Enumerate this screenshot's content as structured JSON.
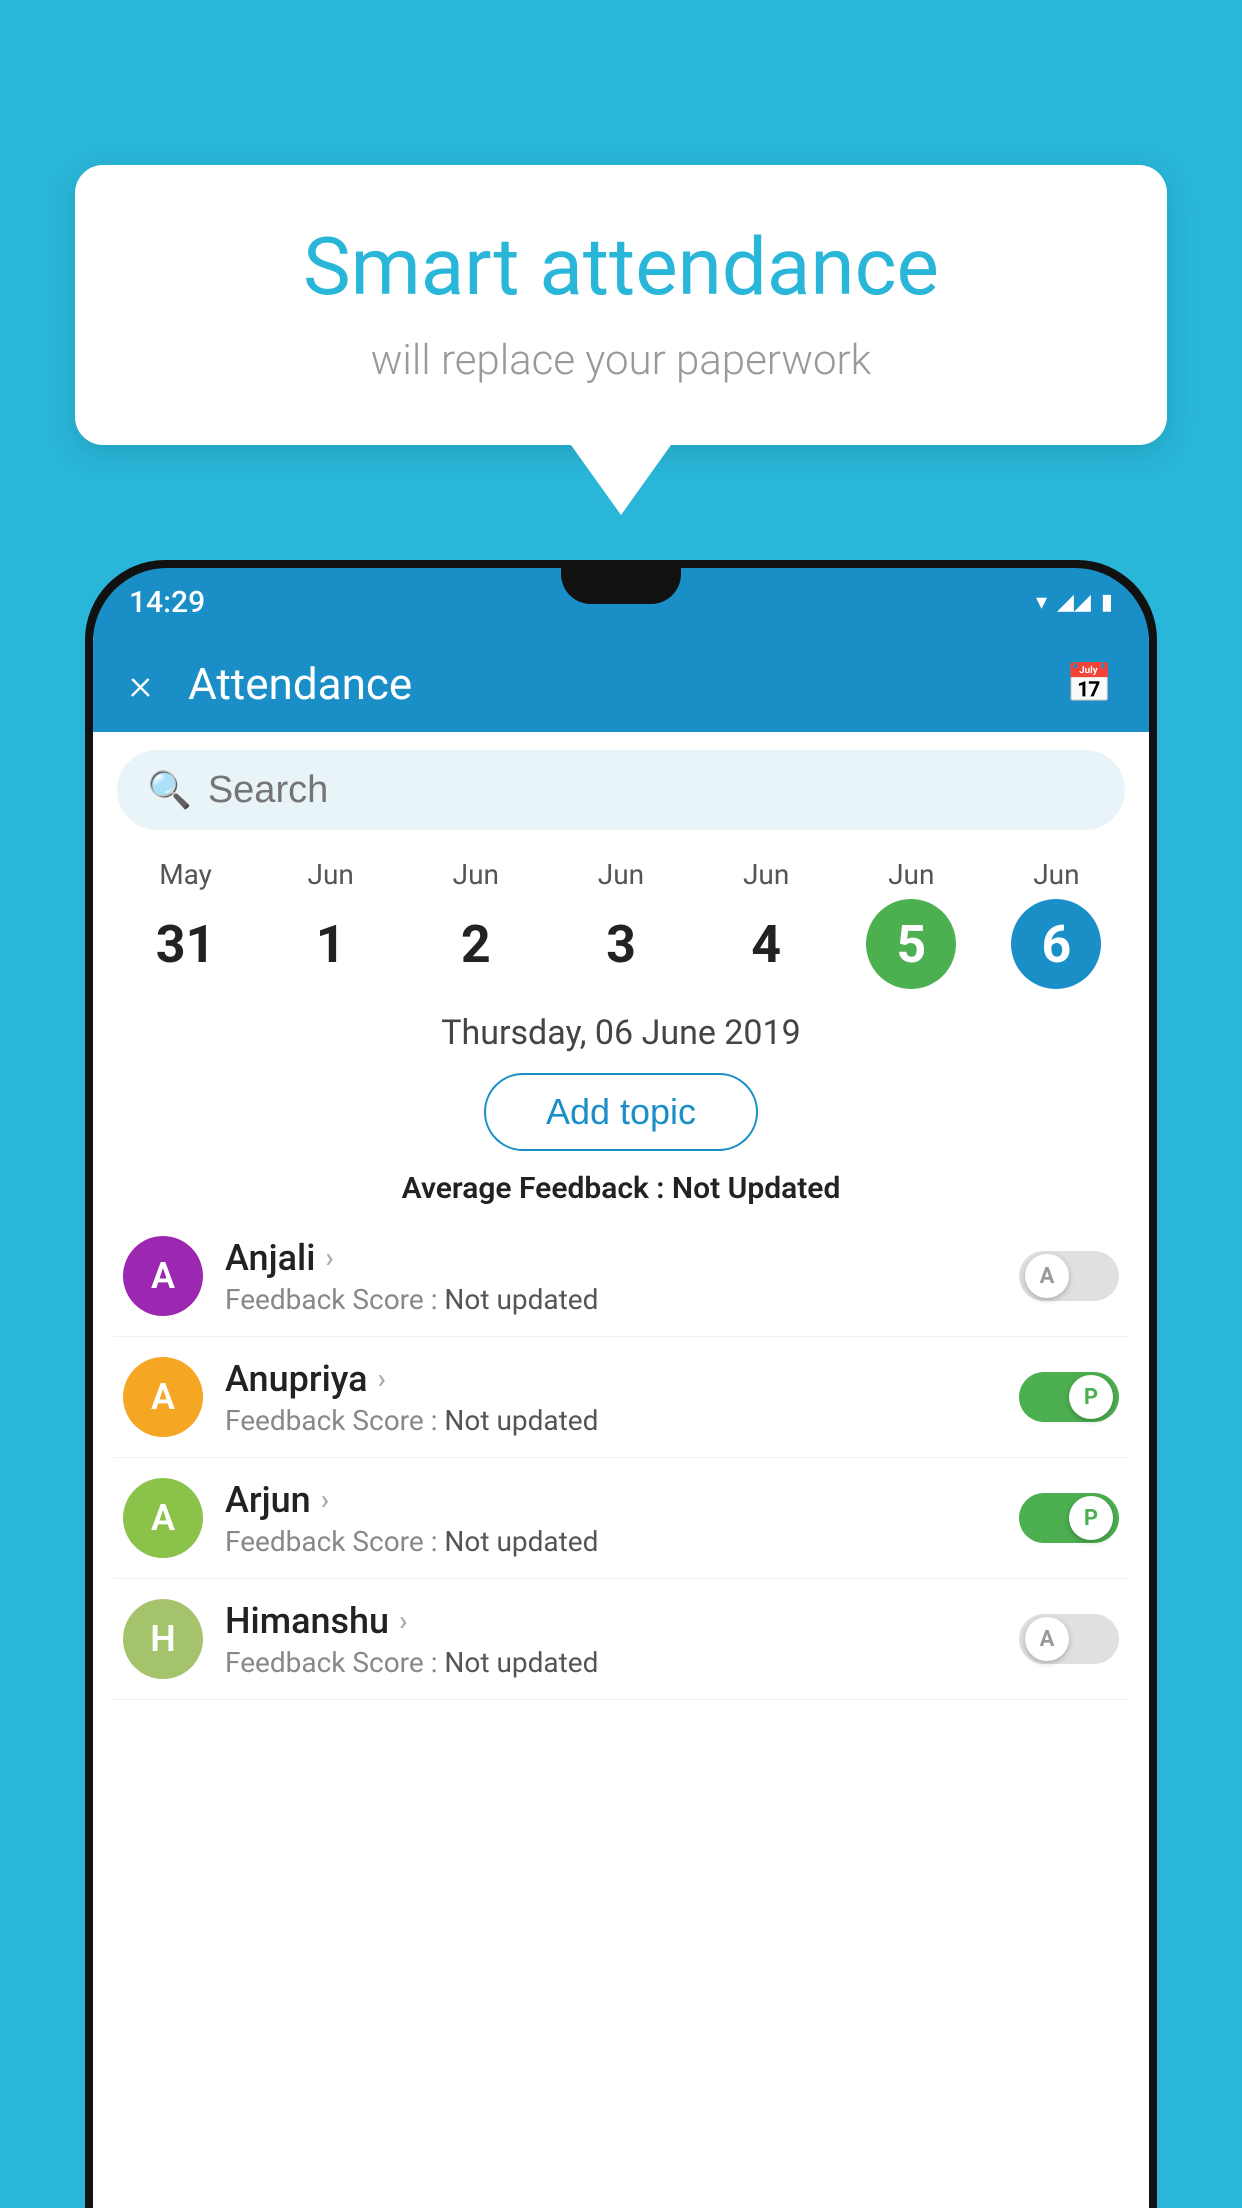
{
  "background_color": "#29b6d8",
  "hero": {
    "title": "Smart attendance",
    "subtitle": "will replace your paperwork"
  },
  "app": {
    "status_bar": {
      "time": "14:29"
    },
    "header": {
      "title": "Attendance",
      "close_label": "×",
      "calendar_icon": "📅"
    },
    "search": {
      "placeholder": "Search"
    },
    "calendar": {
      "days": [
        {
          "month": "May",
          "date": "31",
          "state": "normal"
        },
        {
          "month": "Jun",
          "date": "1",
          "state": "normal"
        },
        {
          "month": "Jun",
          "date": "2",
          "state": "normal"
        },
        {
          "month": "Jun",
          "date": "3",
          "state": "normal"
        },
        {
          "month": "Jun",
          "date": "4",
          "state": "normal"
        },
        {
          "month": "Jun",
          "date": "5",
          "state": "today"
        },
        {
          "month": "Jun",
          "date": "6",
          "state": "selected"
        }
      ]
    },
    "date_label": "Thursday, 06 June 2019",
    "add_topic_label": "Add topic",
    "avg_feedback_label": "Average Feedback :",
    "avg_feedback_value": "Not Updated",
    "students": [
      {
        "name": "Anjali",
        "avatar_letter": "A",
        "avatar_color": "#9c27b0",
        "feedback_label": "Feedback Score :",
        "feedback_value": "Not updated",
        "toggle_state": "off",
        "toggle_letter": "A"
      },
      {
        "name": "Anupriya",
        "avatar_letter": "A",
        "avatar_color": "#f5a623",
        "feedback_label": "Feedback Score :",
        "feedback_value": "Not updated",
        "toggle_state": "on-present",
        "toggle_letter": "P"
      },
      {
        "name": "Arjun",
        "avatar_letter": "A",
        "avatar_color": "#8bc34a",
        "feedback_label": "Feedback Score :",
        "feedback_value": "Not updated",
        "toggle_state": "on-present",
        "toggle_letter": "P"
      },
      {
        "name": "Himanshu",
        "avatar_letter": "H",
        "avatar_color": "#a5c36b",
        "feedback_label": "Feedback Score :",
        "feedback_value": "Not updated",
        "toggle_state": "off",
        "toggle_letter": "A"
      }
    ]
  }
}
